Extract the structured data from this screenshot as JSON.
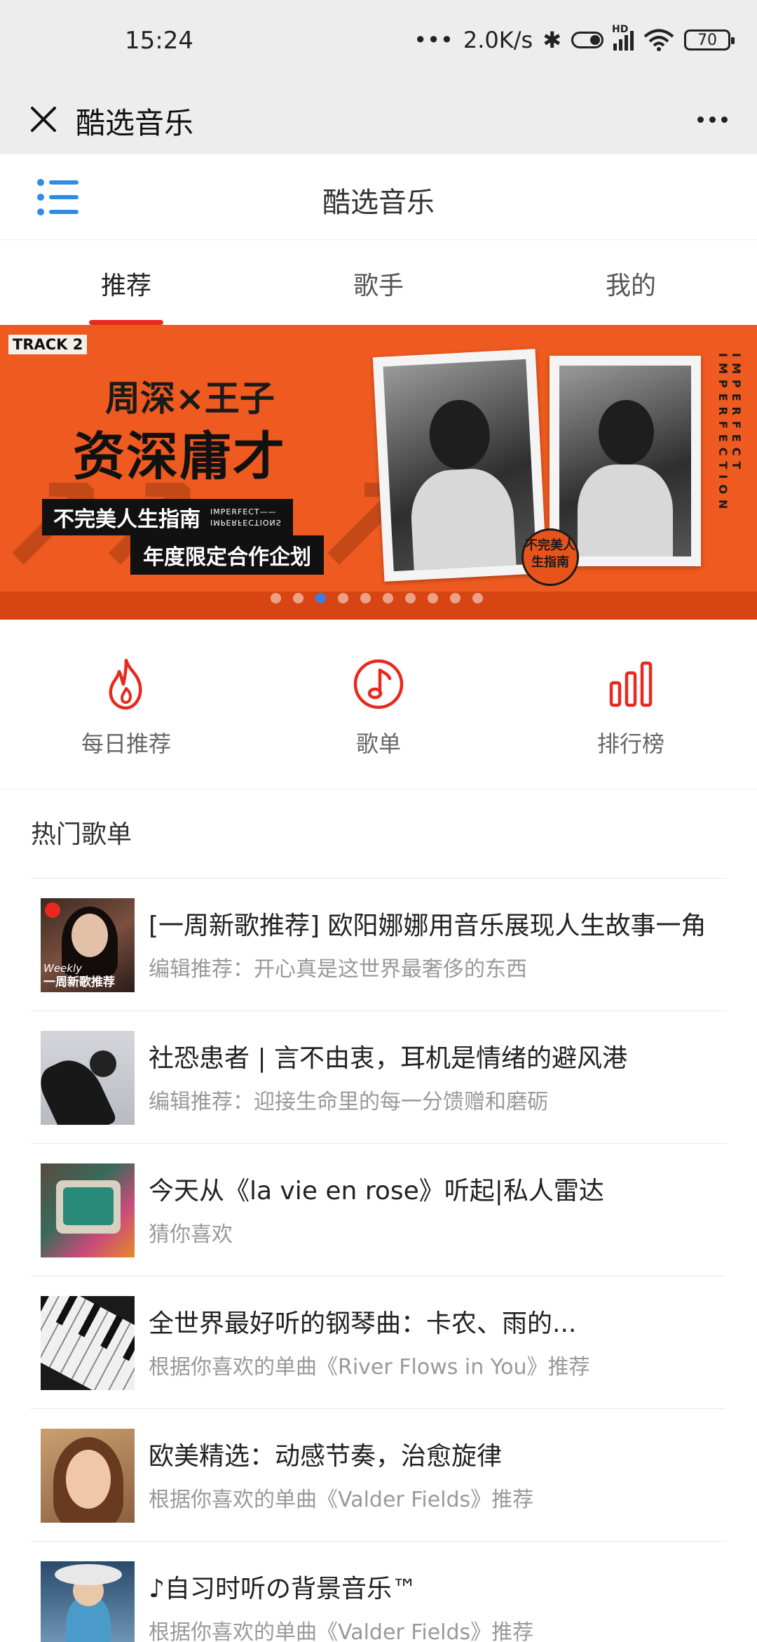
{
  "status_bar": {
    "time": "15:24",
    "network_speed": "2.0K/s",
    "signal_tag": "HD",
    "battery": "70"
  },
  "top_bar": {
    "title": "酷选音乐"
  },
  "page_header": {
    "title": "酷选音乐"
  },
  "tabs": [
    {
      "label": "推荐",
      "active": true
    },
    {
      "label": "歌手",
      "active": false
    },
    {
      "label": "我的",
      "active": false
    }
  ],
  "banner": {
    "track_tag": "TRACK 2",
    "artists": "周深×王子",
    "headline": "资深庸才",
    "subtitle": "不完美人生指南",
    "subtitle_en_1": "IMPERFECT——",
    "subtitle_en_2": "IMPERFECTIONS",
    "subtitle_2": "年度限定合作企划",
    "side_text": "IMPERFECT IMPERFECTION",
    "badge_text": "不完美人生指南",
    "slide_count": 10,
    "active_slide": 3
  },
  "quick_entries": [
    {
      "label": "每日推荐",
      "icon": "flame-icon"
    },
    {
      "label": "歌单",
      "icon": "music-note-icon"
    },
    {
      "label": "排行榜",
      "icon": "bar-chart-icon"
    }
  ],
  "hot_section": {
    "title": "热门歌单"
  },
  "playlists": [
    {
      "title": "[一周新歌推荐] 欧阳娜娜用音乐展现人生故事一角",
      "subtitle": "编辑推荐：开心真是这世界最奢侈的东西",
      "thumb_label_1": "Weekly",
      "thumb_label_2": "一周新歌推荐"
    },
    {
      "title": "社恐患者 | 言不由衷，耳机是情绪的避风港",
      "subtitle": "编辑推荐：迎接生命里的每一分馈赠和磨砺"
    },
    {
      "title": "今天从《la vie en rose》听起|私人雷达",
      "subtitle": "猜你喜欢"
    },
    {
      "title": "全世界最好听的钢琴曲：卡农、雨的...",
      "subtitle": "根据你喜欢的单曲《River Flows in You》推荐"
    },
    {
      "title": "欧美精选：动感节奏，治愈旋律",
      "subtitle": "根据你喜欢的单曲《Valder Fields》推荐"
    },
    {
      "title": "♪自习时听の背景音乐™",
      "subtitle": "根据你喜欢的单曲《Valder Fields》推荐"
    }
  ],
  "colors": {
    "accent": "#e8291f",
    "banner_orange": "#ee5a1f",
    "menu_blue": "#2f8be6",
    "dot_active": "#3d7ee0"
  }
}
